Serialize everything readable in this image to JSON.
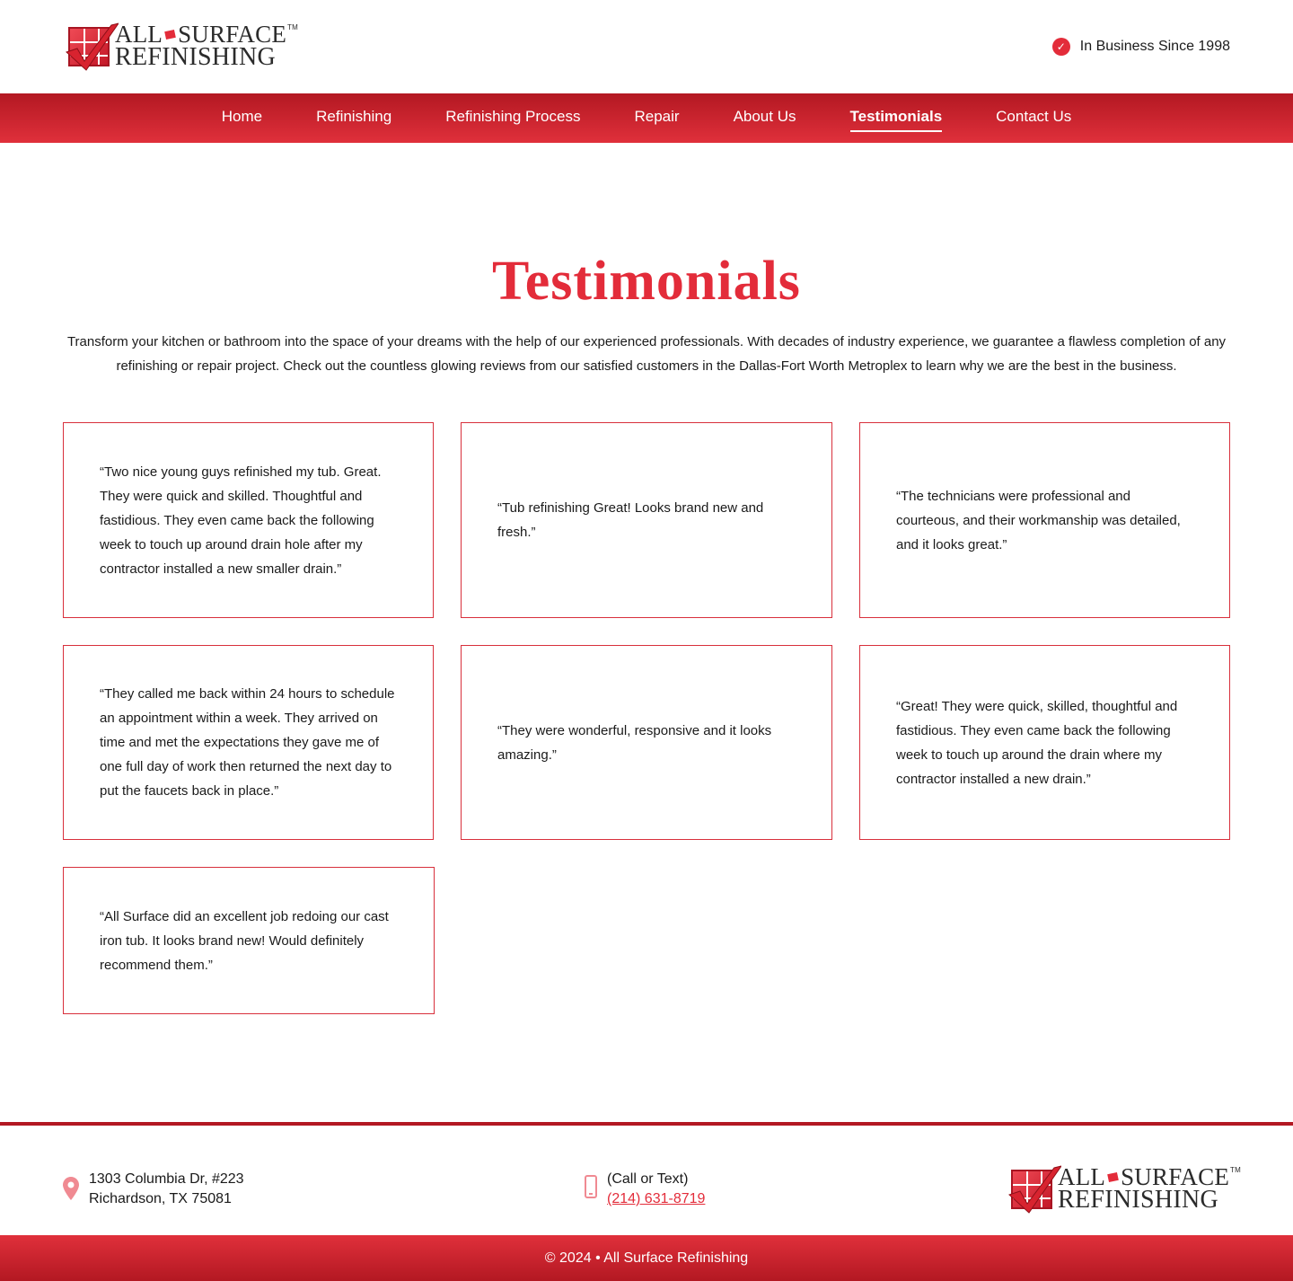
{
  "brand": {
    "line1": "ALL",
    "line1b": "SURFACE",
    "tm": "TM",
    "line2": "REFINISHING"
  },
  "header": {
    "since": "In Business Since 1998"
  },
  "nav": {
    "items": [
      {
        "label": "Home"
      },
      {
        "label": "Refinishing"
      },
      {
        "label": "Refinishing Process"
      },
      {
        "label": "Repair"
      },
      {
        "label": "About Us"
      },
      {
        "label": "Testimonials",
        "active": true
      },
      {
        "label": "Contact Us"
      }
    ]
  },
  "page": {
    "title": "Testimonials",
    "intro": "Transform your kitchen or bathroom into the space of your dreams with the help of our experienced professionals. With decades of industry experience, we guarantee a flawless completion of any refinishing or repair project. Check out the countless glowing reviews from our satisfied customers in the Dallas-Fort Worth Metroplex to learn why we are the best in the business."
  },
  "testimonials": [
    "“Two nice young guys refinished my tub. Great. They were quick and skilled. Thoughtful and fastidious. They even came back the following week to touch up around drain hole after my contractor installed a new smaller drain.”",
    "“Tub refinishing Great! Looks brand new and fresh.”",
    "“The technicians were professional and courteous, and their workmanship was detailed, and it looks great.”",
    "“They called me back within 24 hours to schedule an appointment within a week. They arrived on time and met the expectations they gave me of one full day of work then returned the next day to put the faucets back in place.”",
    "“They were wonderful, responsive and it looks amazing.”",
    "“Great! They were quick, skilled, thoughtful and fastidious. They even came back the following week to touch up around the drain where my contractor installed a new drain.”",
    "“All Surface did an excellent job redoing our cast iron tub. It looks brand new! Would definitely recommend them.”"
  ],
  "footer": {
    "address_line1": "1303 Columbia Dr, #223",
    "address_line2": "Richardson, TX 75081",
    "phone_label": "(Call or Text)",
    "phone_number": "(214) 631-8719",
    "copyright": "© 2024 • All Surface Refinishing"
  },
  "colors": {
    "brand_red": "#e32c3a",
    "dark_red": "#b31822"
  }
}
